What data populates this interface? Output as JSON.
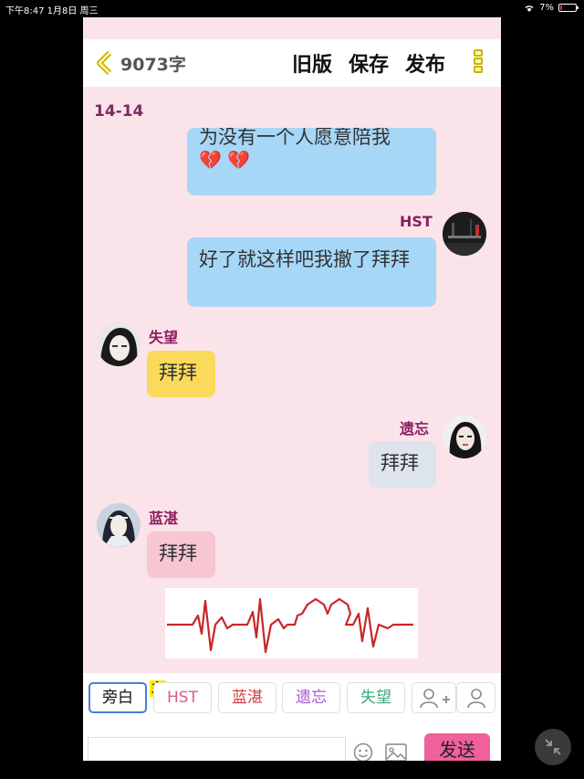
{
  "status_bar": {
    "time_date": "下午8:47  1月8日 周三",
    "battery": "7%"
  },
  "header": {
    "word_count": "9073字",
    "old_version": "旧版",
    "save": "保存",
    "publish": "发布"
  },
  "chapter": {
    "title": "14-14"
  },
  "messages": [
    {
      "speaker": "",
      "text": "为没有一个人愿意陪我",
      "emoji": "💔 💔",
      "side": "right"
    },
    {
      "speaker": "HST",
      "text": "好了就这样吧我撤了拜拜",
      "side": "right"
    },
    {
      "speaker": "失望",
      "text": "拜拜",
      "side": "left"
    },
    {
      "speaker": "遗忘",
      "text": "拜拜",
      "side": "right"
    },
    {
      "speaker": "蓝湛",
      "text": "拜拜",
      "side": "left"
    }
  ],
  "characters": {
    "narration": "旁白",
    "host_badge": "主",
    "hst": "HST",
    "lanzhan": "蓝湛",
    "yiwang": "遗忘",
    "shiwang": "失望"
  },
  "input": {
    "placeholder": ""
  },
  "send": "发送",
  "colors": {
    "accent_pink": "#f0609b",
    "name_color": "#8b1e5e",
    "blue_bubble": "#a7d7f7"
  }
}
